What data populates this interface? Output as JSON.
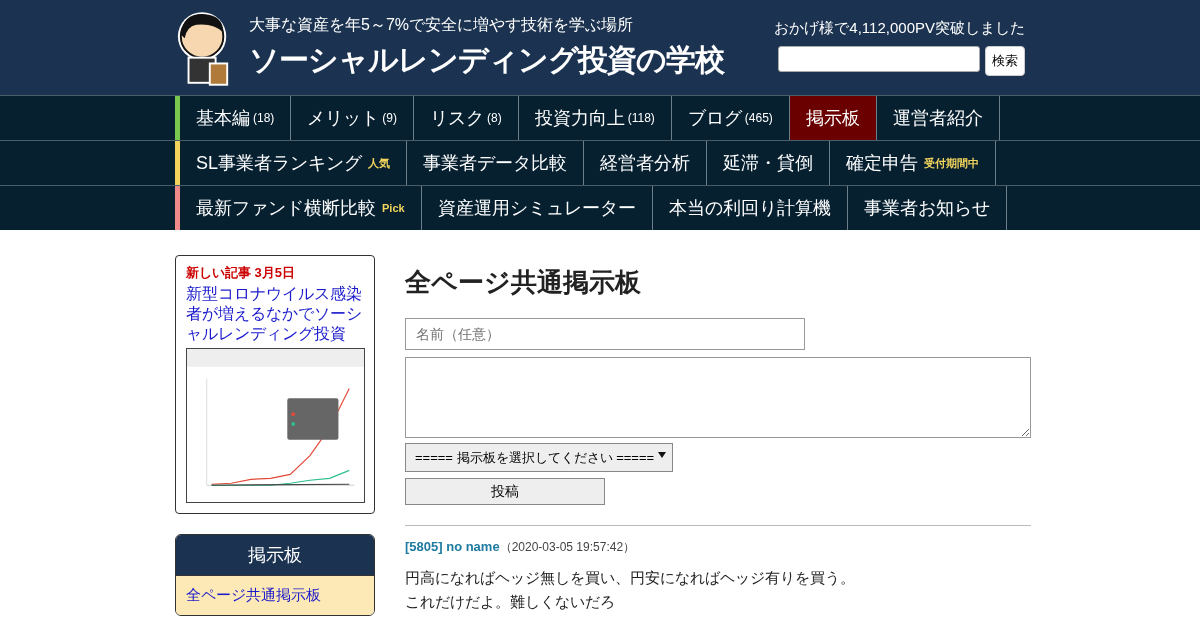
{
  "header": {
    "tagline": "大事な資産を年5～7%で安全に増やす技術を学ぶ場所",
    "title": "ソーシャルレンディング投資の学校",
    "pv_notice": "おかげ様で4,112,000PV突破しました",
    "search": {
      "button": "検索"
    }
  },
  "nav_rows": [
    {
      "color": "#7ac74f",
      "items": [
        {
          "label": "基本編",
          "count": "(18)",
          "selected": false
        },
        {
          "label": "メリット",
          "count": "(9)",
          "selected": false
        },
        {
          "label": "リスク",
          "count": "(8)",
          "selected": false
        },
        {
          "label": "投資力向上",
          "count": "(118)",
          "selected": false
        },
        {
          "label": "ブログ",
          "count": "(465)",
          "selected": false
        },
        {
          "label": "掲示板",
          "selected": true
        },
        {
          "label": "運営者紹介",
          "selected": false
        }
      ]
    },
    {
      "color": "#f2d45c",
      "items": [
        {
          "label": "SL事業者ランキング",
          "badge": "人気",
          "selected": false
        },
        {
          "label": "事業者データ比較",
          "selected": false
        },
        {
          "label": "経営者分析",
          "selected": false
        },
        {
          "label": "延滞・貸倒",
          "selected": false
        },
        {
          "label": "確定申告",
          "badge": "受付期間中",
          "selected": false
        }
      ]
    },
    {
      "color": "#f08a8a",
      "items": [
        {
          "label": "最新ファンド横断比較",
          "badge": "Pick",
          "selected": false
        },
        {
          "label": "資産運用シミュレーター",
          "selected": false
        },
        {
          "label": "本当の利回り計算機",
          "selected": false
        },
        {
          "label": "事業者お知らせ",
          "selected": false
        }
      ]
    }
  ],
  "sidebar": {
    "new_article": {
      "heading": "新しい記事 3月5日",
      "link": "新型コロナウイルス感染者が増えるなかでソーシャルレンディング投資"
    },
    "board_menu": {
      "title": "掲示板",
      "items": [
        {
          "label": "全ページ共通掲示板",
          "selected": true
        }
      ]
    }
  },
  "main": {
    "title": "全ページ共通掲示板",
    "form": {
      "name_placeholder": "名前（任意）",
      "board_select": "===== 掲示板を選択してください =====",
      "submit": "投稿"
    },
    "posts": [
      {
        "id": "[5805] no name",
        "date": "（2020-03-05 19:57:42）",
        "lines": [
          "円高になればヘッジ無しを買い、円安になればヘッジ有りを買う。",
          "これだけだよ。難しくないだろ"
        ]
      }
    ]
  }
}
